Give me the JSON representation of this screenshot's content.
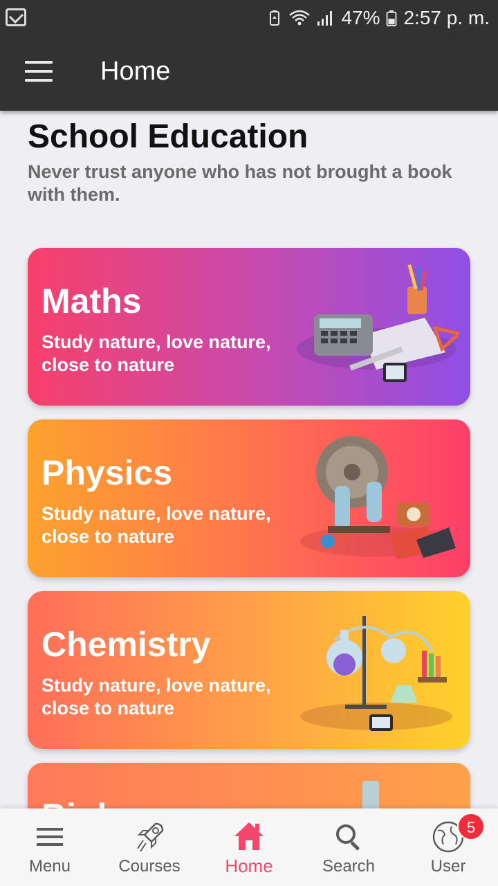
{
  "status_bar": {
    "battery": "47%",
    "time": "2:57 p. m."
  },
  "app_bar": {
    "title": "Home"
  },
  "main": {
    "heading": "School Education",
    "subheading": "Never trust anyone who has not brought a book with them."
  },
  "cards": [
    {
      "title": "Maths",
      "description": "Study nature, love nature, close to nature"
    },
    {
      "title": "Physics",
      "description": "Study nature, love nature, close to nature"
    },
    {
      "title": "Chemistry",
      "description": "Study nature, love nature, close to nature"
    },
    {
      "title": "Biology",
      "description": ""
    }
  ],
  "bottom_nav": {
    "items": [
      {
        "label": "Menu",
        "icon": "menu-icon"
      },
      {
        "label": "Courses",
        "icon": "rocket-icon"
      },
      {
        "label": "Home",
        "icon": "home-icon"
      },
      {
        "label": "Search",
        "icon": "search-icon"
      },
      {
        "label": "User",
        "icon": "globe-icon"
      }
    ],
    "active": "Home",
    "user_badge": "5"
  },
  "colors": {
    "accent": "#f4476b",
    "appbar": "#323232",
    "background": "#efeef2"
  }
}
